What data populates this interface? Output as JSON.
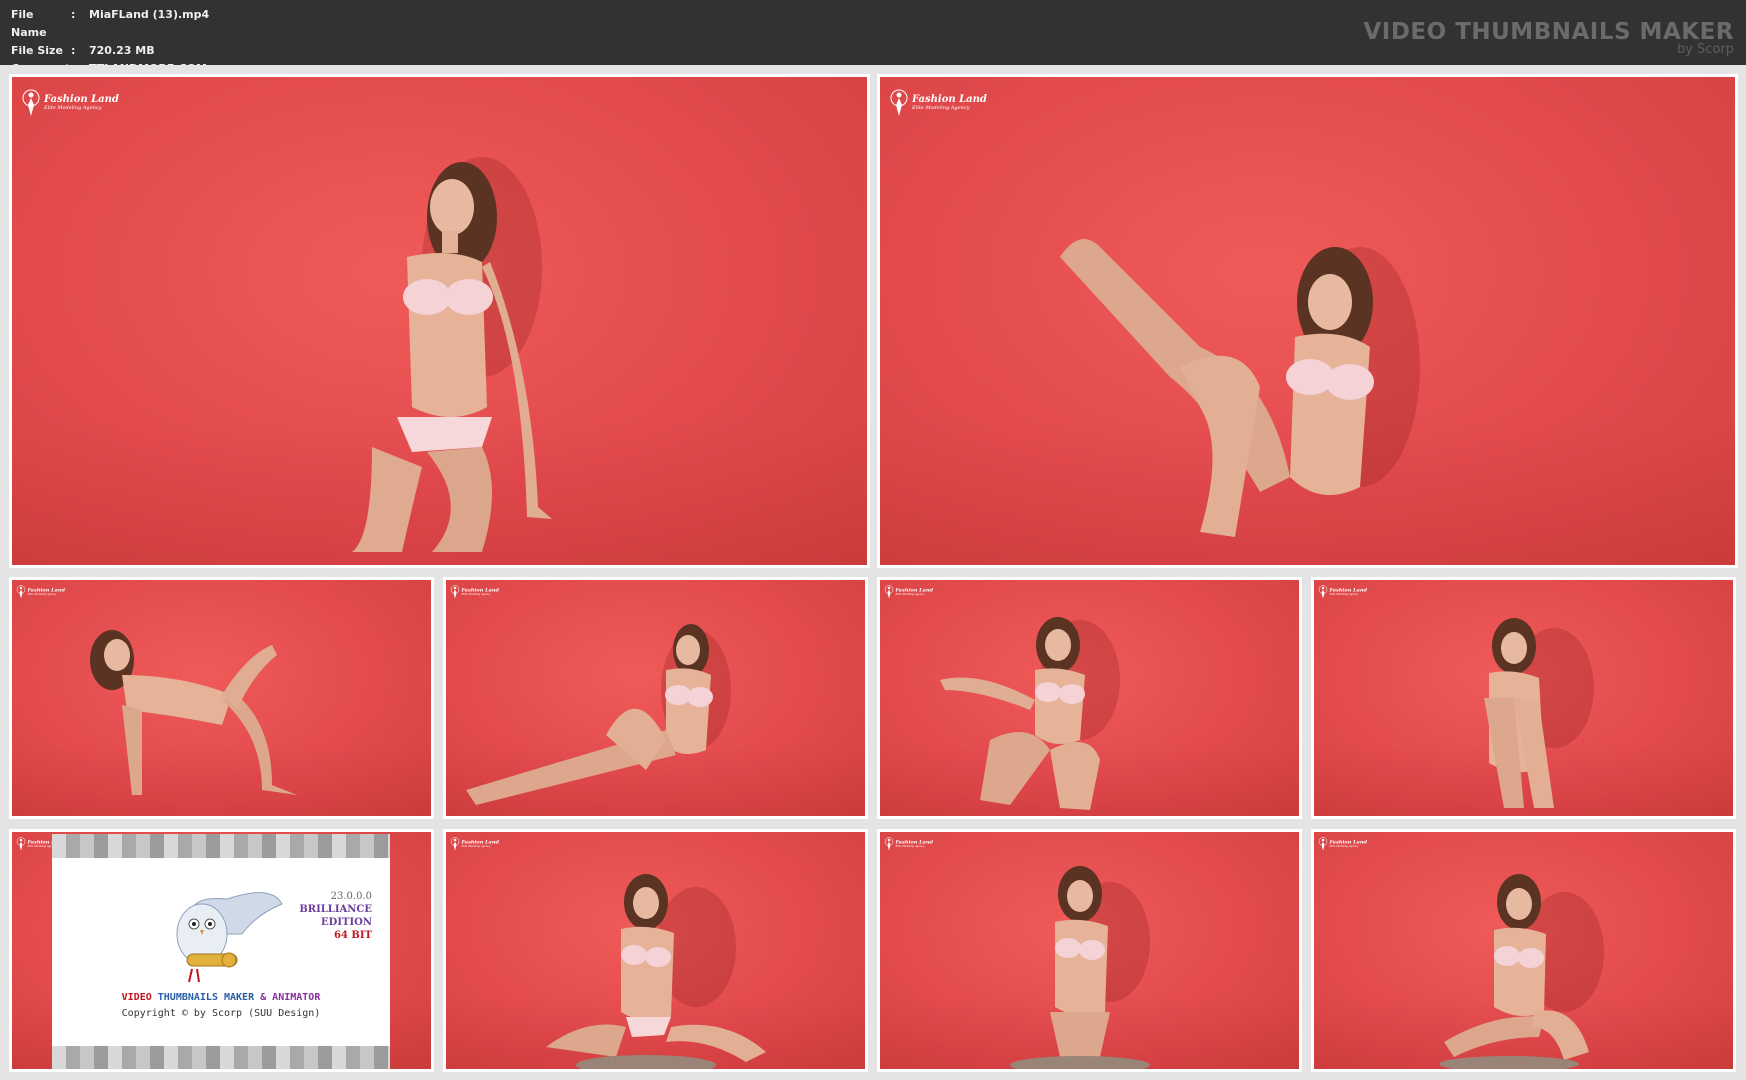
{
  "header": {
    "info": [
      {
        "key": "File Name",
        "value": "MiaFLand (13).mp4"
      },
      {
        "key": "File Size",
        "value": "720.23 MB"
      },
      {
        "key": "Comment",
        "value": "TTLANDMORE.COM"
      }
    ],
    "brand_main": "VIDEO THUMBNAILS MAKER",
    "brand_sub": "by Scorp"
  },
  "watermark": {
    "title": "Fashion Land",
    "subtitle": "Elite Modeling Agency"
  },
  "promo": {
    "version": "23.0.0.0",
    "edition_line1": "BRILLIANCE",
    "edition_line2": "EDITION",
    "bits": "64 BIT",
    "title_part1": "VIDEO",
    "title_part2": " THUMBNAILS MAKER",
    "title_part3": " & ANIMATOR",
    "copyright": "Copyright © by Scorp (SUU Design)"
  },
  "colors": {
    "backdrop": "#e24a4c",
    "header_bg": "#323232",
    "grid_bg": "#e4e4e4",
    "accent_red": "#c0171e",
    "accent_blue": "#2b5ea8",
    "accent_purple": "#8a2fa0"
  }
}
